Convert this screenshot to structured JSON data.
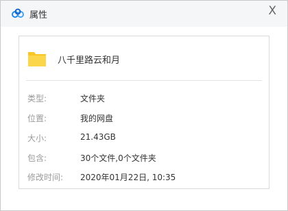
{
  "window": {
    "title": "属性",
    "close_label": "X"
  },
  "icons": {
    "app": "baidu-netdisk-cloud-icon",
    "folder": "folder-icon"
  },
  "file": {
    "name": "八千里路云和月"
  },
  "properties": [
    {
      "label": "类型:",
      "value": "文件夹"
    },
    {
      "label": "位置:",
      "value": "我的网盘"
    },
    {
      "label": "大小:",
      "value": "21.43GB"
    },
    {
      "label": "包含:",
      "value": "30个文件,0个文件夹"
    },
    {
      "label": "修改时间:",
      "value": "2020年01月22日, 10:35"
    }
  ],
  "colors": {
    "accent": "#1e88e5",
    "folder": "#f9c623",
    "label_text": "#9a9a9a"
  }
}
